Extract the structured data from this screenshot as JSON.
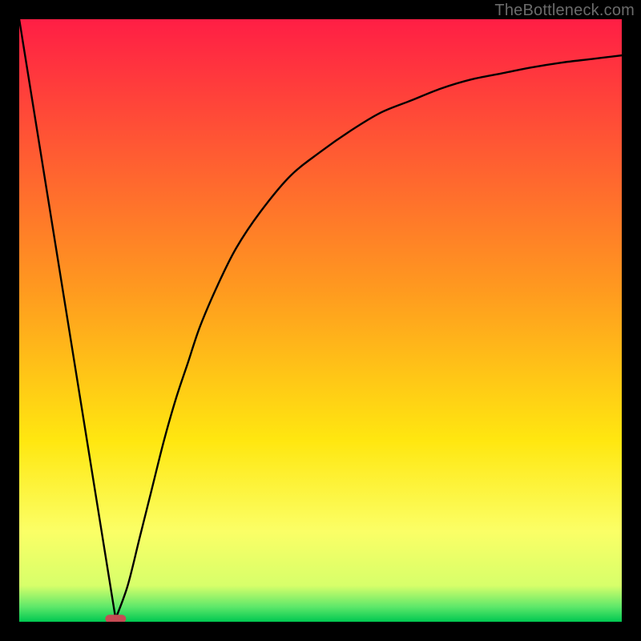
{
  "watermark": "TheBottleneck.com",
  "chart_data": {
    "type": "line",
    "title": "",
    "xlabel": "",
    "ylabel": "",
    "xlim": [
      0,
      1
    ],
    "ylim": [
      0,
      1
    ],
    "background_gradient": {
      "stops": [
        {
          "offset": 0.0,
          "color": "#ff1e45"
        },
        {
          "offset": 0.45,
          "color": "#ff9a1f"
        },
        {
          "offset": 0.7,
          "color": "#ffe710"
        },
        {
          "offset": 0.85,
          "color": "#fbff66"
        },
        {
          "offset": 0.94,
          "color": "#d7ff6a"
        },
        {
          "offset": 0.975,
          "color": "#5fe86a"
        },
        {
          "offset": 1.0,
          "color": "#00c851"
        }
      ]
    },
    "minimum_marker": {
      "x": 0.16,
      "y": 0.005,
      "color": "#c64b54"
    },
    "series": [
      {
        "name": "left-segment",
        "description": "Straight line from top-left falling to the minimum",
        "x": [
          0.0,
          0.16
        ],
        "y": [
          1.0,
          0.005
        ]
      },
      {
        "name": "right-segment",
        "description": "Curve rising from the minimum toward upper-right (approximate)",
        "x": [
          0.16,
          0.18,
          0.2,
          0.22,
          0.24,
          0.26,
          0.28,
          0.3,
          0.33,
          0.36,
          0.4,
          0.45,
          0.5,
          0.55,
          0.6,
          0.65,
          0.7,
          0.75,
          0.8,
          0.85,
          0.9,
          0.95,
          1.0
        ],
        "y": [
          0.005,
          0.06,
          0.14,
          0.22,
          0.3,
          0.37,
          0.43,
          0.49,
          0.56,
          0.62,
          0.68,
          0.74,
          0.78,
          0.815,
          0.845,
          0.865,
          0.885,
          0.9,
          0.91,
          0.92,
          0.928,
          0.934,
          0.94
        ]
      }
    ]
  }
}
